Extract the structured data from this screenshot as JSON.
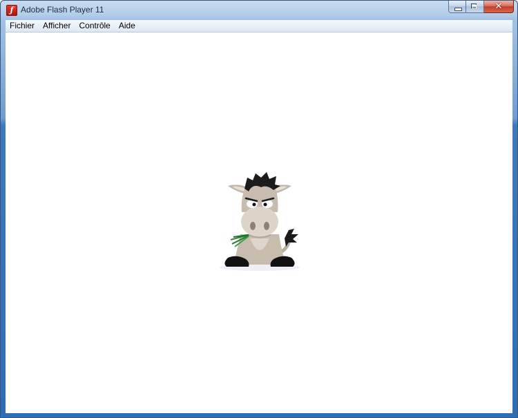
{
  "window": {
    "title": "Adobe Flash Player 11",
    "app_icon": "flash-player-icon",
    "caption_buttons": [
      {
        "name": "minimize",
        "icon": "minimize-icon"
      },
      {
        "name": "maximize",
        "icon": "maximize-icon"
      },
      {
        "name": "close",
        "icon": "close-icon",
        "glyph": "✕"
      }
    ]
  },
  "menu": {
    "items": [
      {
        "label": "Fichier"
      },
      {
        "label": "Afficher"
      },
      {
        "label": "Contrôle"
      },
      {
        "label": "Aide"
      }
    ]
  },
  "content": {
    "image": "donkey-mascot-illustration"
  },
  "colors": {
    "title_bar": "#b4cde9",
    "frame_bottom": "#2f6db4",
    "close_button": "#c2402a",
    "content_background": "#ffffff"
  }
}
